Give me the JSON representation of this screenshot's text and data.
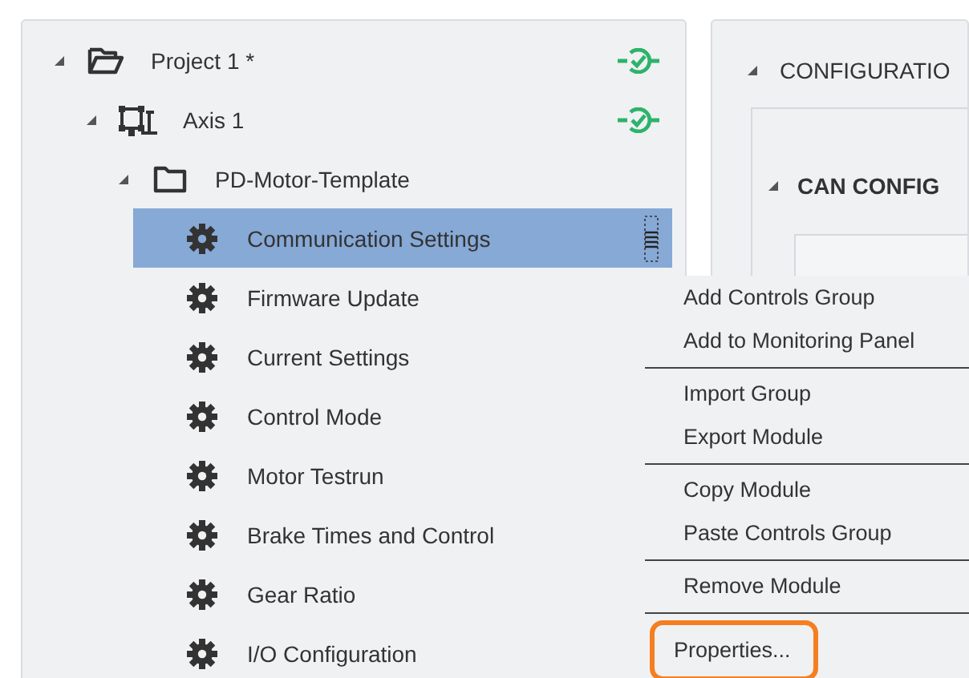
{
  "tree": [
    {
      "label": "Project 1 *",
      "kind": "project",
      "expanded": true,
      "selected": false,
      "connected": true,
      "children": [
        {
          "label": "Axis 1",
          "kind": "axis",
          "expanded": true,
          "selected": false,
          "connected": true,
          "children": [
            {
              "label": "PD-Motor-Template",
              "kind": "folder",
              "expanded": true,
              "selected": false,
              "connected": false,
              "children": [
                {
                  "label": "Communication Settings",
                  "kind": "module",
                  "selected": true,
                  "connected": false
                },
                {
                  "label": "Firmware Update",
                  "kind": "module",
                  "selected": false,
                  "connected": false
                },
                {
                  "label": "Current Settings",
                  "kind": "module",
                  "selected": false,
                  "connected": false
                },
                {
                  "label": "Control Mode",
                  "kind": "module",
                  "selected": false,
                  "connected": false
                },
                {
                  "label": "Motor Testrun",
                  "kind": "module",
                  "selected": false,
                  "connected": false
                },
                {
                  "label": "Brake Times and Control",
                  "kind": "module",
                  "selected": false,
                  "connected": false
                },
                {
                  "label": "Gear Ratio",
                  "kind": "module",
                  "selected": false,
                  "connected": false
                },
                {
                  "label": "I/O Configuration",
                  "kind": "module",
                  "selected": false,
                  "connected": false
                }
              ]
            }
          ]
        }
      ]
    }
  ],
  "configuration": {
    "title": "CONFIGURATIO",
    "expanded": true,
    "section": {
      "title": "CAN CONFIG",
      "expanded": true
    }
  },
  "context_menu": [
    [
      {
        "label": "Add Controls Group",
        "highlighted": false
      },
      {
        "label": "Add to Monitoring Panel",
        "highlighted": false
      }
    ],
    [
      {
        "label": "Import Group",
        "highlighted": false
      },
      {
        "label": "Export Module",
        "highlighted": false
      }
    ],
    [
      {
        "label": "Copy Module",
        "highlighted": false
      },
      {
        "label": "Paste Controls Group",
        "highlighted": false
      }
    ],
    [
      {
        "label": "Remove Module",
        "highlighted": false
      }
    ],
    [
      {
        "label": "Properties...",
        "highlighted": true
      }
    ]
  ]
}
